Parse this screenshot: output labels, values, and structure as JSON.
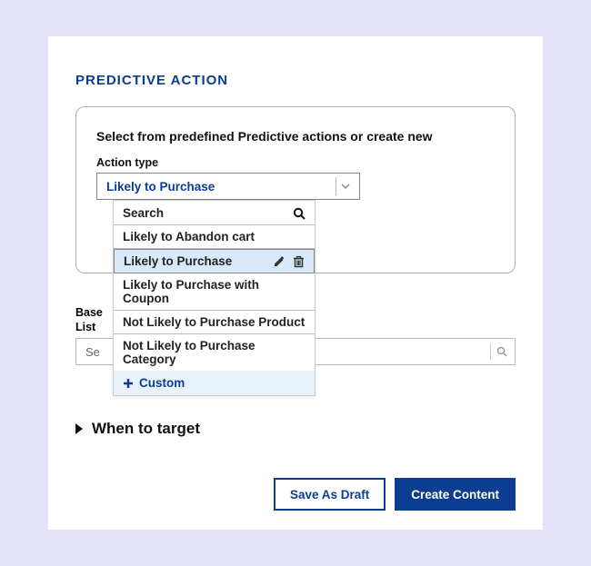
{
  "section_title": "PREDICTIVE ACTION",
  "panel": {
    "description": "Select from predefined Predictive actions or create new",
    "action_type_label": "Action type",
    "selected_value": "Likely to Purchase"
  },
  "dropdown": {
    "search_placeholder": "Search",
    "options": [
      "Likely to Abandon cart",
      "Likely to Purchase",
      "Likely to Purchase with Coupon",
      "Not Likely to Purchase Product",
      "Not Likely to Purchase Category"
    ],
    "selected_index": 1,
    "custom_label": "Custom"
  },
  "base": {
    "label_line1": "Base",
    "label_line2": "List",
    "search_placeholder_short": "Se"
  },
  "when_to_target": "When to target",
  "footer": {
    "save_draft": "Save As Draft",
    "create_content": "Create Content"
  }
}
